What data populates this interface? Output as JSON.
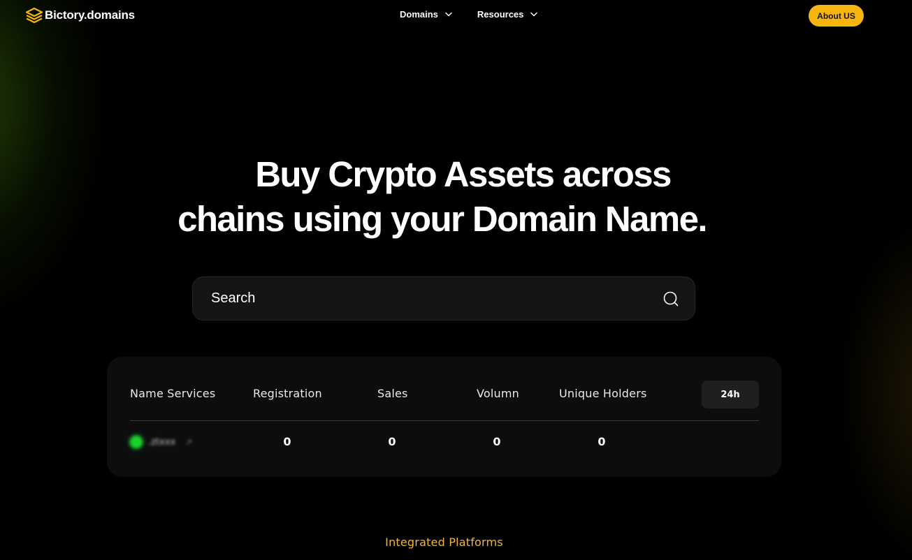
{
  "nav": {
    "logo_text": "Bictory.domains",
    "logo_icon": "hexagon-layers-icon",
    "menu": [
      {
        "label": "Domains"
      },
      {
        "label": "Resources"
      }
    ],
    "about_label": "About US"
  },
  "hero": {
    "title_line1": "Buy Crypto Assets across",
    "title_line2": "chains using your Domain Name."
  },
  "search": {
    "placeholder": "Search",
    "value": ""
  },
  "stats": {
    "columns": [
      "Name Services",
      "Registration",
      "Sales",
      "Volumn",
      "Unique Holders"
    ],
    "period": "24h",
    "rows": [
      {
        "service_name": ".ztxxx",
        "service_link": "↗",
        "registration": "0",
        "sales": "0",
        "volume": "0",
        "unique_holders": "0"
      }
    ]
  },
  "integrated_label": "Integrated Platforms",
  "colors": {
    "accent": "#f7b50f",
    "accent_text": "#f3b733",
    "panel": "#0d0d0d",
    "search_bg": "#141414",
    "service_dot": "#1bd12c"
  }
}
